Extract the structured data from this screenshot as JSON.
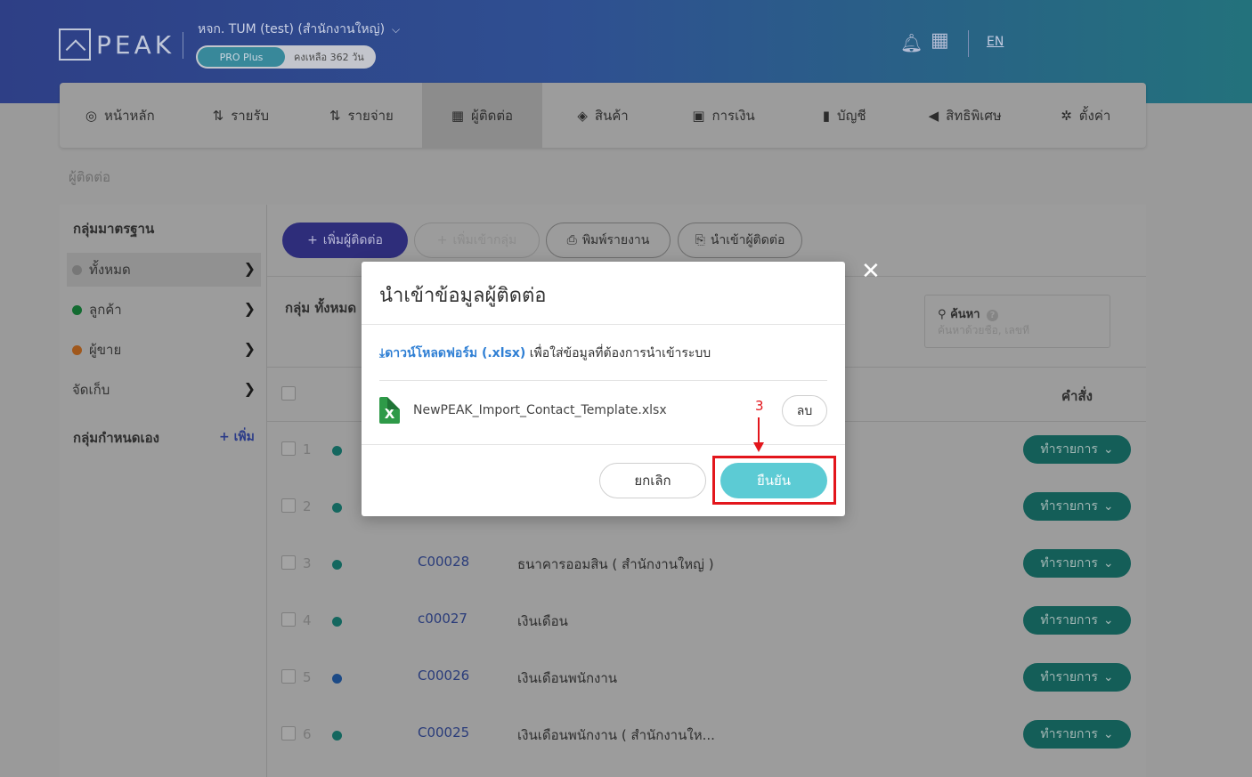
{
  "header": {
    "logo_text": "PEAK",
    "company_name": "หจก. TUM (test) (สำนักงานใหญ่)",
    "plan_badge": "PRO Plus",
    "plan_remaining": "คงเหลือ 362 วัน",
    "language": "EN"
  },
  "nav": {
    "items": [
      {
        "label": "หน้าหลัก",
        "icon": "dashboard-icon",
        "glyph": "◎"
      },
      {
        "label": "รายรับ",
        "icon": "income-icon",
        "glyph": "⇅"
      },
      {
        "label": "รายจ่าย",
        "icon": "expense-icon",
        "glyph": "⇅"
      },
      {
        "label": "ผู้ติดต่อ",
        "icon": "contacts-icon",
        "glyph": "▦"
      },
      {
        "label": "สินค้า",
        "icon": "box-icon",
        "glyph": "◈"
      },
      {
        "label": "การเงิน",
        "icon": "money-icon",
        "glyph": "▣"
      },
      {
        "label": "บัญชี",
        "icon": "book-icon",
        "glyph": "▮"
      },
      {
        "label": "สิทธิพิเศษ",
        "icon": "megaphone-icon",
        "glyph": "◀"
      },
      {
        "label": "ตั้งค่า",
        "icon": "gear-icon",
        "glyph": "✲"
      }
    ],
    "active_index": 3
  },
  "breadcrumb": "ผู้ติดต่อ",
  "sidebar": {
    "standard_heading": "กลุ่มมาตรฐาน",
    "items": [
      {
        "label": "ทั้งหมด",
        "dot": "#777777"
      },
      {
        "label": "ลูกค้า",
        "dot": "#136b31"
      },
      {
        "label": "ผู้ขาย",
        "dot": "#a0581c"
      },
      {
        "label": "จัดเก็บ",
        "dot": ""
      }
    ],
    "custom_heading": "กลุ่มกำหนดเอง",
    "add_label": "+ เพิ่ม"
  },
  "toolbar": {
    "add_contact": "เพิ่มผู้ติดต่อ",
    "add_to_group": "เพิ่มเข้ากลุ่ม",
    "print_report": "พิมพ์รายงาน",
    "import_contacts": "นำเข้าผู้ติดต่อ"
  },
  "group_label": "กลุ่ม ทั้งหมด",
  "search": {
    "label": "ค้นหา",
    "placeholder": "ค้นหาด้วยชื่อ, เลขที่"
  },
  "table": {
    "command_header": "คำสั่ง",
    "action_label": "ทำรายการ",
    "rows": [
      {
        "num": "1",
        "dot": "#14675f",
        "code": "",
        "name": ""
      },
      {
        "num": "2",
        "dot": "#14675f",
        "code": "",
        "name": ""
      },
      {
        "num": "3",
        "dot": "#14675f",
        "code": "C00028",
        "name": "ธนาคารออมสิน ( สำนักงานใหญ่ )"
      },
      {
        "num": "4",
        "dot": "#14675f",
        "code": "c00027",
        "name": "เงินเดือน"
      },
      {
        "num": "5",
        "dot": "#1c4a86",
        "code": "C00026",
        "name": "เงินเดือนพนักงาน"
      },
      {
        "num": "6",
        "dot": "#14675f",
        "code": "C00025",
        "name": "เงินเดือนพนักงาน ( สำนักงานให..."
      }
    ]
  },
  "modal": {
    "title": "นำเข้าข้อมูลผู้ติดต่อ",
    "download_link": "ดาวน์โหลดฟอร์ม (.xlsx)",
    "download_desc": " เพื่อใส่ข้อมูลที่ต้องการนำเข้าระบบ",
    "file_name": "NewPEAK_Import_Contact_Template.xlsx",
    "delete_label": "ลบ",
    "cancel_label": "ยกเลิก",
    "confirm_label": "ยืนยัน",
    "close_glyph": "✕"
  },
  "annotation": {
    "step_number": "3",
    "color": "#e3161c"
  }
}
